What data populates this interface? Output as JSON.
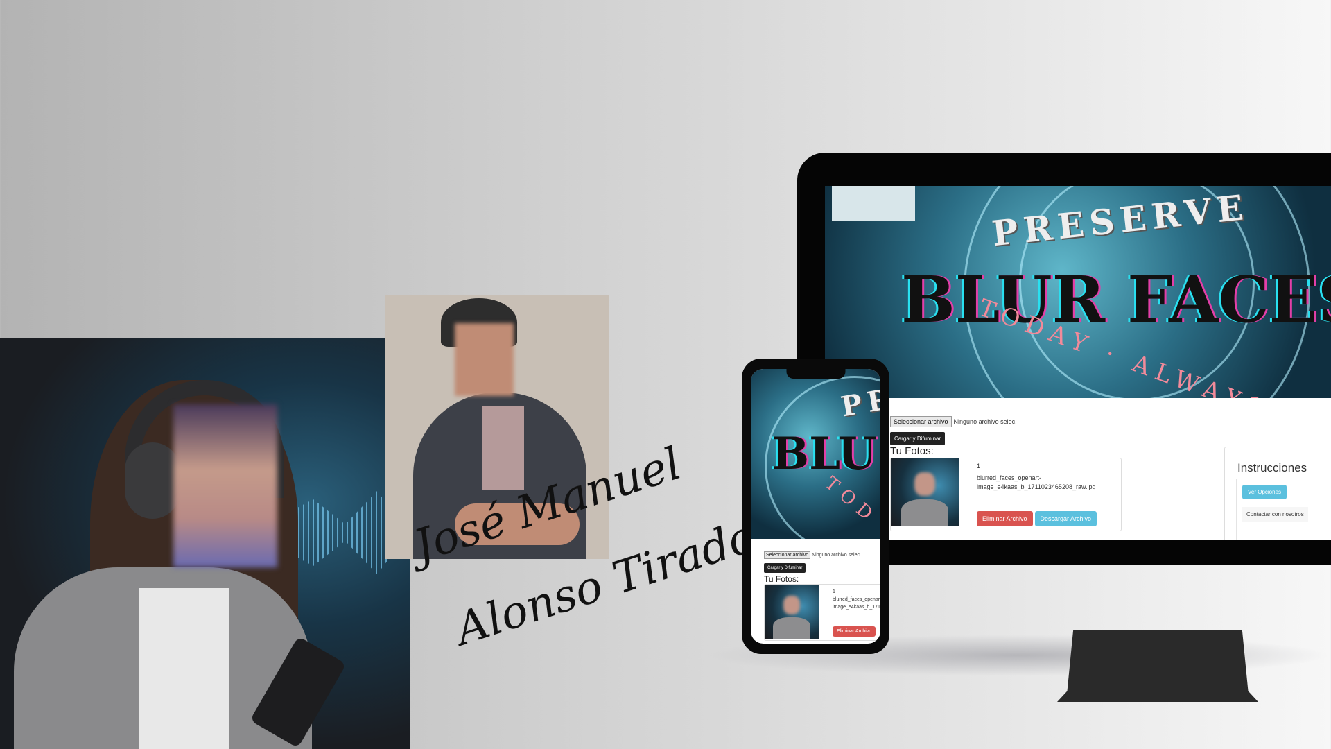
{
  "signature": {
    "line1": "José Manuel",
    "line2": "Alonso Tirado"
  },
  "banner": {
    "top_text": "PRESERVE",
    "title": "BLUR FACES",
    "bottom_text": "TODAY · ALWAYS"
  },
  "phone_banner": {
    "top_text": "PR",
    "title": "BLU",
    "bottom_text": "TOD"
  },
  "app": {
    "file_button": "Seleccionar archivo",
    "file_status": "Ninguno archivo selec.",
    "upload_button": "Cargar y Difuminar",
    "photos_heading": "Tu Fotos:",
    "photo": {
      "index": "1",
      "filename_line1": "blurred_faces_openart-",
      "filename_line2": "image_e4kaas_b_1711023465208_raw.jpg",
      "phone_line1": "blurred_faces_openart",
      "phone_line2": "image_e4kaas_b_171"
    },
    "delete_button": "Eliminar Archivo",
    "download_button": "Descargar Archivo",
    "instructions": {
      "title": "Instrucciones",
      "options_button": "Ver Opciones",
      "contact_button": "Contactar con nosotros"
    }
  }
}
